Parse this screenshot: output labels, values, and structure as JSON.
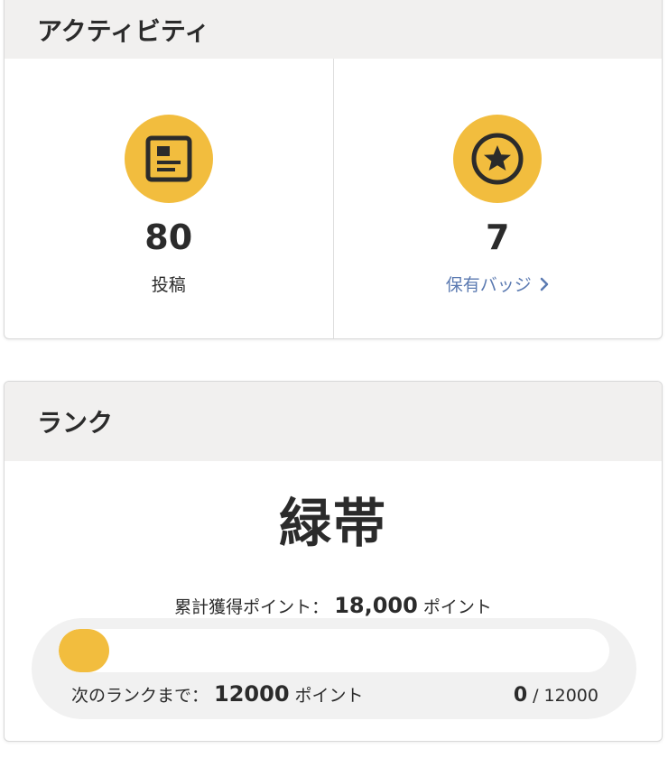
{
  "activity": {
    "title": "アクティビティ",
    "posts": {
      "count": "80",
      "label": "投稿",
      "icon": "document-icon"
    },
    "badges": {
      "count": "7",
      "label": "保有バッジ",
      "icon": "star-badge-icon"
    }
  },
  "rank": {
    "title": "ランク",
    "name": "緑帯",
    "total_points_label": "累計獲得ポイント：",
    "total_points_value": "18,000",
    "points_unit": "ポイント",
    "next_rank_label": "次のランクまで：",
    "next_rank_value": "12000",
    "progress_current": "0",
    "progress_separator": "/",
    "progress_max": "12000",
    "progress_fraction": 0
  },
  "colors": {
    "accent": "#f2bd3e",
    "link": "#5b7ab1",
    "header_bg": "#f1f0ef",
    "text": "#2b2b2b"
  }
}
